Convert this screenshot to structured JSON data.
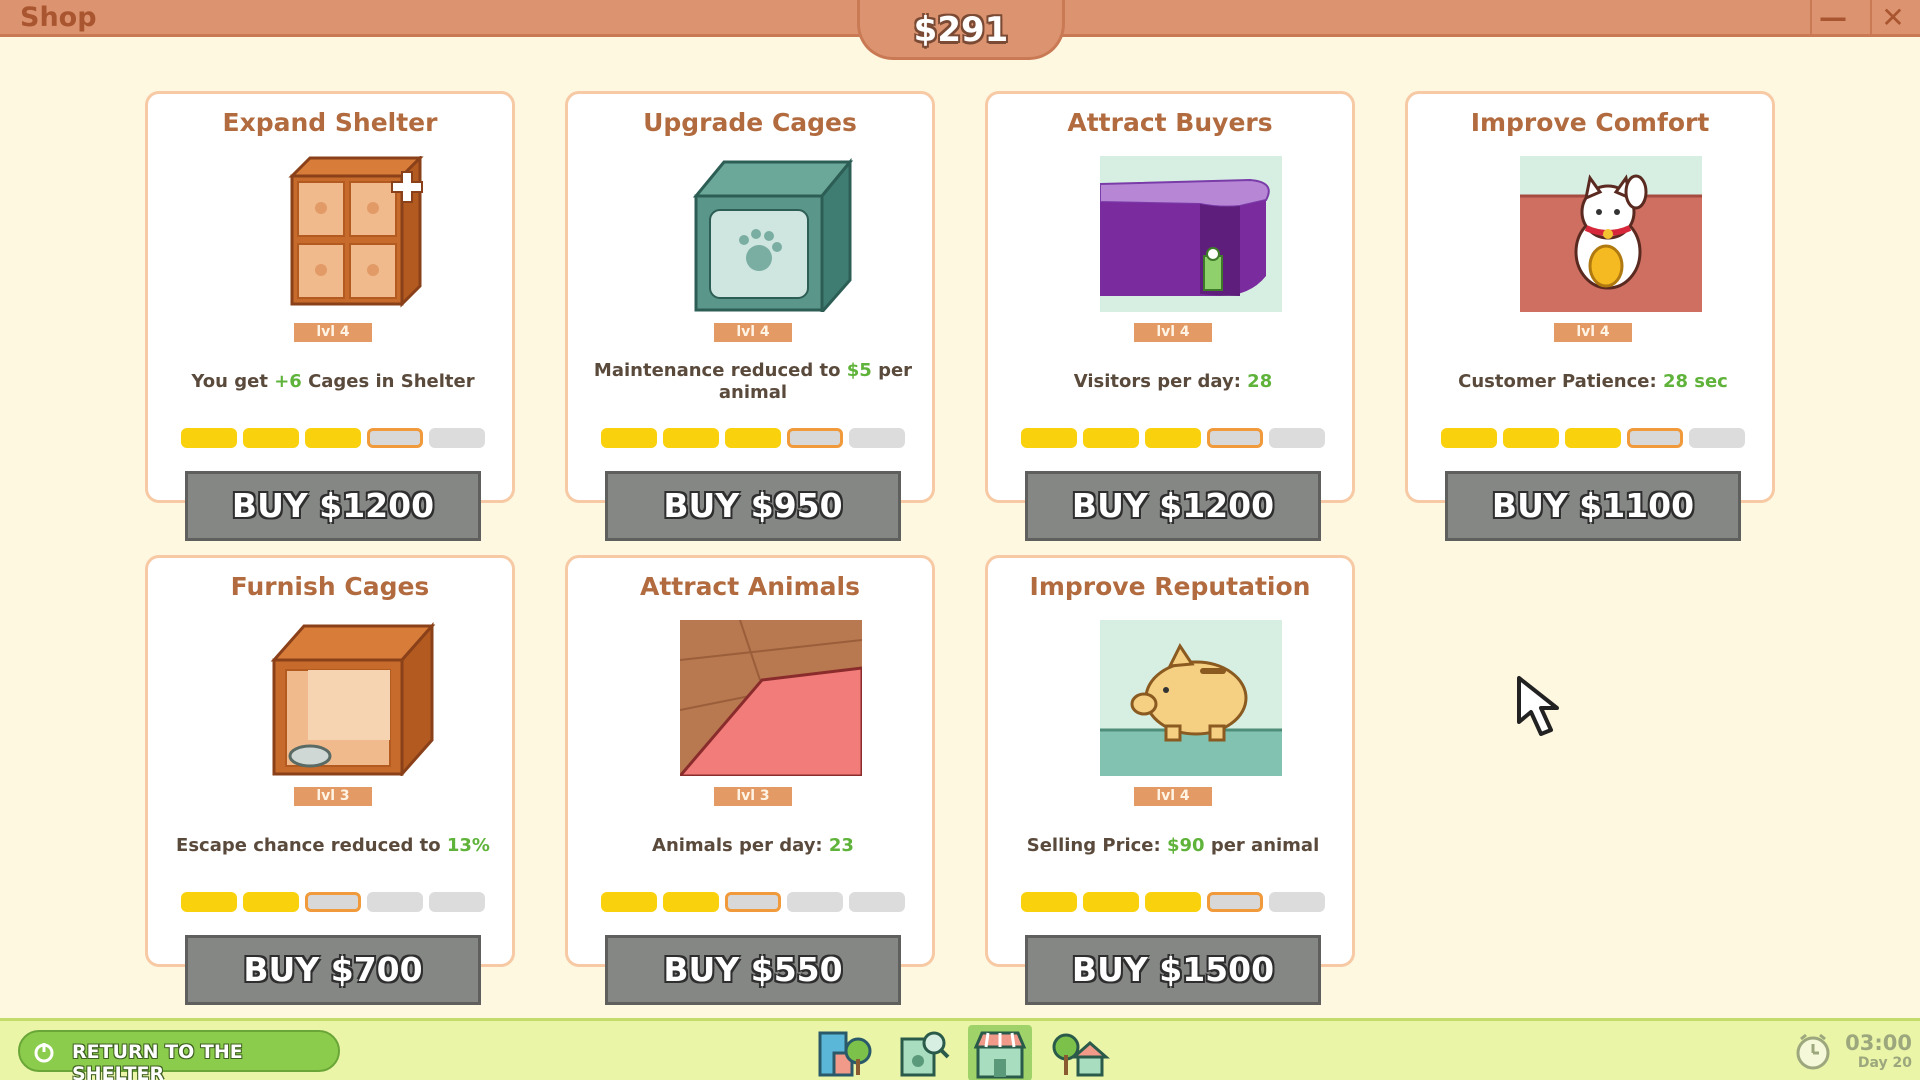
{
  "window": {
    "title": "Shop",
    "minimize_symbol": "—",
    "close_symbol": "✕"
  },
  "money": "$291",
  "cards": [
    {
      "title": "Expand Shelter",
      "icon": "shelter-expand-icon",
      "level": "lvl 4",
      "desc_pre": "You get ",
      "desc_value": "+6",
      "desc_post": " Cages in Shelter",
      "progress": 3,
      "buy": "BUY $1200"
    },
    {
      "title": "Upgrade Cages",
      "icon": "cage-upgrade-icon",
      "level": "lvl 4",
      "desc_pre": "Maintenance reduced to ",
      "desc_value": "$5",
      "desc_post": " per animal",
      "progress": 3,
      "buy": "BUY $950"
    },
    {
      "title": "Attract Buyers",
      "icon": "reception-desk-icon",
      "level": "lvl 4",
      "desc_pre": "Visitors per day: ",
      "desc_value": "28",
      "desc_post": "",
      "progress": 3,
      "buy": "BUY $1200"
    },
    {
      "title": "Improve Comfort",
      "icon": "lucky-cat-icon",
      "level": "lvl 4",
      "desc_pre": "Customer Patience: ",
      "desc_value": "28 sec",
      "desc_post": "",
      "progress": 3,
      "buy": "BUY $1100"
    },
    {
      "title": "Furnish Cages",
      "icon": "furnished-cage-icon",
      "level": "lvl 3",
      "desc_pre": "Escape chance reduced to ",
      "desc_value": "13%",
      "desc_post": "",
      "progress": 2,
      "buy": "BUY $700"
    },
    {
      "title": "Attract Animals",
      "icon": "carpet-floor-icon",
      "level": "lvl 3",
      "desc_pre": "Animals per day: ",
      "desc_value": "23",
      "desc_post": "",
      "progress": 2,
      "buy": "BUY $550"
    },
    {
      "title": "Improve Reputation",
      "icon": "piggy-bank-icon",
      "level": "lvl 4",
      "desc_pre": "Selling Price: ",
      "desc_value": "$90",
      "desc_post": " per animal",
      "progress": 3,
      "buy": "BUY $1500"
    }
  ],
  "bottom": {
    "return_label": "RETURN TO THE SHELTER",
    "nav": [
      "city-icon",
      "adoption-board-icon",
      "shop-icon",
      "home-icon"
    ],
    "active_nav": "shop-icon",
    "time": "03:00",
    "day": "Day 20"
  },
  "colors": {
    "accent_green": "#5fb33a",
    "pip_filled": "#f9d10c",
    "pip_next_border": "#f19a3b",
    "titlebar": "#dc9470"
  }
}
